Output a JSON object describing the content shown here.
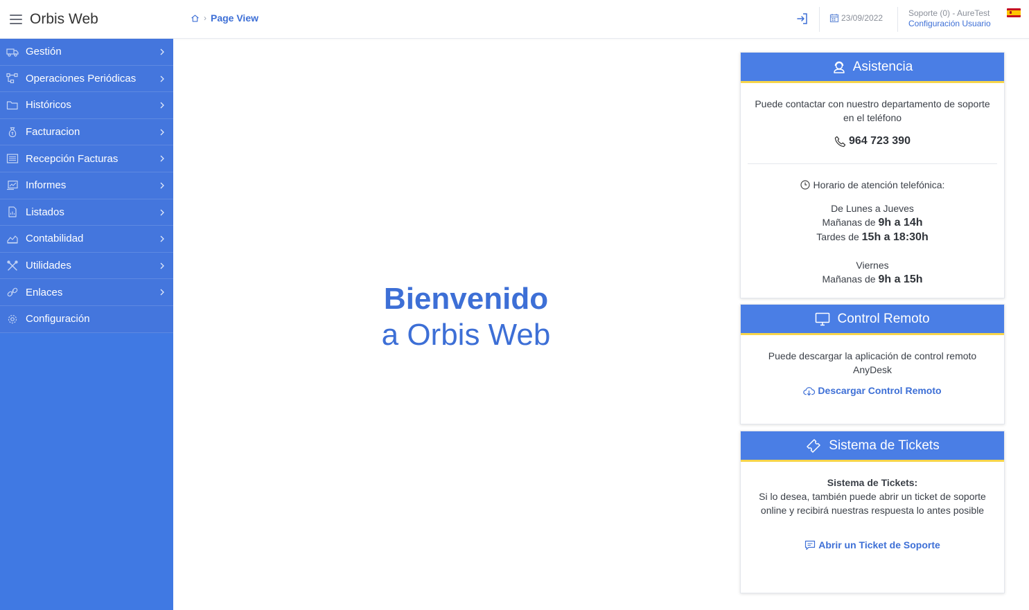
{
  "app": {
    "title": "Orbis Web"
  },
  "breadcrumb": {
    "current": "Page View"
  },
  "header": {
    "date": "23/09/2022",
    "user": "Soporte (0) - AureTest",
    "config_link": "Configuración Usuario"
  },
  "sidebar": {
    "items": [
      {
        "label": "Gestión",
        "icon": "truck-icon"
      },
      {
        "label": "Operaciones Periódicas",
        "icon": "workflow-icon"
      },
      {
        "label": "Históricos",
        "icon": "folder-icon"
      },
      {
        "label": "Facturacion",
        "icon": "money-bag-icon"
      },
      {
        "label": "Recepción Facturas",
        "icon": "list-icon"
      },
      {
        "label": "Informes",
        "icon": "report-icon"
      },
      {
        "label": "Listados",
        "icon": "document-icon"
      },
      {
        "label": "Contabilidad",
        "icon": "chart-icon"
      },
      {
        "label": "Utilidades",
        "icon": "tools-icon"
      },
      {
        "label": "Enlaces",
        "icon": "link-icon"
      },
      {
        "label": "Configuración",
        "icon": "gear-icon"
      }
    ]
  },
  "welcome": {
    "title": "Bienvenido",
    "subtitle": "a Orbis Web"
  },
  "asistencia": {
    "title": "Asistencia",
    "intro": "Puede contactar con nuestro departamento de soporte en el teléfono",
    "phone": "964 723 390",
    "hours_title": "Horario de atención telefónica:",
    "weekdays_label": "De Lunes a Jueves",
    "morning_prefix": "Mañanas de ",
    "morning_hours": "9h a 14h",
    "afternoon_prefix": "Tardes de ",
    "afternoon_hours": "15h a 18:30h",
    "friday_label": "Viernes",
    "friday_morning_prefix": "Mañanas de ",
    "friday_morning_hours": "9h a 15h"
  },
  "control_remoto": {
    "title": "Control Remoto",
    "text": "Puede descargar la aplicación de control remoto AnyDesk",
    "link": "Descargar Control Remoto"
  },
  "tickets": {
    "title": "Sistema de Tickets",
    "heading": "Sistema de Tickets:",
    "text": "Si lo desea, también puede abrir un ticket de soporte online y recibirá nuestras respuesta lo antes posible",
    "link": "Abrir un Ticket de Soporte"
  },
  "colors": {
    "sidebar": "#4079e3",
    "accent": "#3d6fd6",
    "card_header": "#4a7ee5",
    "card_stripe": "#f7d54a"
  }
}
